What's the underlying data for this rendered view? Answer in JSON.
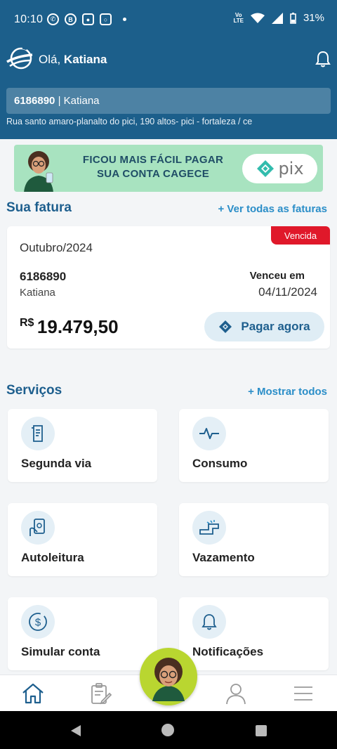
{
  "status_bar": {
    "time": "10:10",
    "battery": "31%",
    "network": "LTE"
  },
  "header": {
    "greeting_prefix": "Olá,",
    "user_name": "Katiana",
    "account_number": "6186890",
    "account_separator": " | ",
    "account_name": "Katiana",
    "address": "Rua santo amaro-planalto do pici, 190 altos- pici - fortaleza / ce"
  },
  "banner": {
    "line1": "FICOU MAIS FÁCIL PAGAR",
    "line2": "SUA CONTA CAGECE",
    "pix_label": "pix"
  },
  "invoice_section": {
    "title": "Sua fatura",
    "link": "+ Ver todas as faturas",
    "badge": "Vencida",
    "month": "Outubro/2024",
    "account_number": "6186890",
    "account_name": "Katiana",
    "due_label": "Venceu em",
    "due_date": "04/11/2024",
    "currency": "R$",
    "amount": "19.479,50",
    "pay_label": "Pagar agora"
  },
  "services_section": {
    "title": "Serviços",
    "link": "+ Mostrar todos",
    "items": [
      {
        "label": "Segunda via",
        "icon": "document-icon"
      },
      {
        "label": "Consumo",
        "icon": "pulse-icon"
      },
      {
        "label": "Autoleitura",
        "icon": "phone-hand-icon"
      },
      {
        "label": "Vazamento",
        "icon": "leaking-pipe-icon"
      },
      {
        "label": "Simular conta",
        "icon": "dollar-coin-icon"
      },
      {
        "label": "Notificações",
        "icon": "bell-icon"
      }
    ]
  },
  "bottom_nav": {
    "items": [
      "home-icon",
      "clipboard-edit-icon",
      "assistant-avatar",
      "profile-icon",
      "menu-icon"
    ]
  },
  "colors": {
    "header_bg": "#1c5f8b",
    "primary": "#1e5f8e",
    "link": "#2b8ec8",
    "badge_red": "#e0182a",
    "banner_bg": "#a8e3c0",
    "assistant_bg": "#b9d630"
  }
}
